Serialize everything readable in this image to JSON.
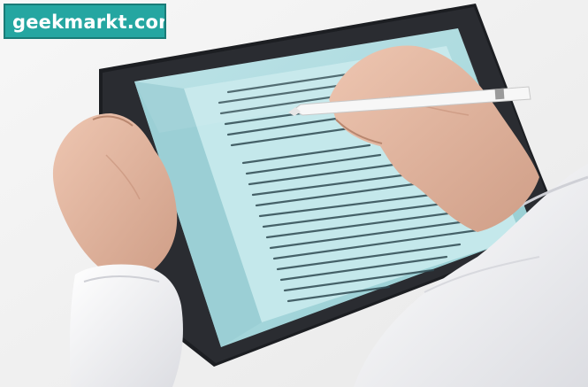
{
  "watermark": {
    "text": "geekmarkt.com"
  },
  "colors": {
    "background": "#f2f2f2",
    "screen": "#a9dade",
    "bezel": "#1c1e22",
    "paper": "#bfe5e8",
    "watermark_bg": "#25a6a1",
    "skin": "#e1b6a0",
    "sleeve": "#f4f4f6"
  },
  "objects": [
    "tablet",
    "stylus",
    "left-hand",
    "right-hand",
    "shirt-sleeve",
    "document"
  ]
}
